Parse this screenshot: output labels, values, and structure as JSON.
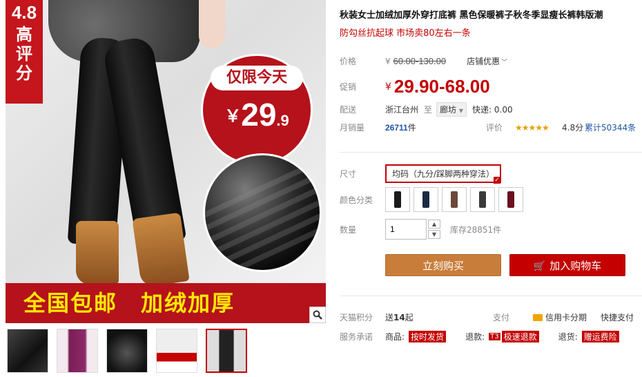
{
  "main_image": {
    "badge_score": "4.8",
    "badge_chars": [
      "高",
      "评",
      "分"
    ],
    "promo_top": "仅限今天",
    "promo_currency": "￥",
    "promo_price_int": "29",
    "promo_price_dec": ".9",
    "banner_left": "全国包邮",
    "banner_right": "加绒加厚"
  },
  "thumbnails": [
    "thumb-1",
    "thumb-2",
    "thumb-3",
    "thumb-4",
    "thumb-5"
  ],
  "product": {
    "title": "秋装女士加绒加厚外穿打底裤 黑色保暖裤子秋冬季显瘦长裤韩版潮",
    "subtitle": "防勾丝抗起球 市场卖80左右一条"
  },
  "price": {
    "label": "价格",
    "currency": "¥",
    "original": "60.00-130.00",
    "discount_label": "店铺优惠",
    "promo_label": "促销",
    "promo_currency": "¥",
    "promo_value": "29.90-68.00"
  },
  "shipping": {
    "label": "配送",
    "from": "浙江台州",
    "to_word": "至",
    "destination": "廊坊",
    "fee": "快递: 0.00"
  },
  "sales": {
    "label": "月销量",
    "count": "26711",
    "unit": "件",
    "rating_label": "评价",
    "stars": "★★★★★",
    "score": "4.8分",
    "total": "累计50344条"
  },
  "size": {
    "label": "尺寸",
    "selected": "均码（九分/踩脚两种穿法）"
  },
  "color": {
    "label": "颜色分类",
    "swatches": [
      "#1a1a1a",
      "#1d2a44",
      "#6b4a3a",
      "#3a3a3a",
      "#6a1020"
    ]
  },
  "quantity": {
    "label": "数量",
    "value": "1",
    "stock": "库存28851件"
  },
  "actions": {
    "buy_now": "立刻购买",
    "add_to_cart": "加入购物车"
  },
  "points": {
    "label": "天猫积分",
    "text": "送",
    "amount": "14",
    "suffix": "起",
    "pay_label": "支付",
    "card_label": "信用卡分期",
    "quick_pay": "快捷支付"
  },
  "service": {
    "label": "服务承诺",
    "goods_label": "商品:",
    "goods_tag": "按时发货",
    "refund_label": "退款:",
    "refund_t3": "T3",
    "refund_tag": "极速退款",
    "return_label": "退货:",
    "return_tag": "赠运费险"
  }
}
